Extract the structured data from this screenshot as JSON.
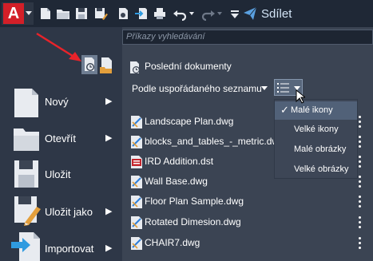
{
  "toolbar": {
    "app_letter": "A",
    "share_label": "Sdílet",
    "icons": [
      "new-icon",
      "open-icon",
      "save-icon",
      "save-as-icon",
      "open-web-icon",
      "import-icon",
      "plot-icon",
      "undo-icon",
      "redo-icon",
      "customize-icon",
      "share-icon"
    ]
  },
  "search": {
    "placeholder": "Příkazy vyhledávání"
  },
  "menu": {
    "items": [
      {
        "label": "Nový",
        "icon": "new-document-icon",
        "has_arrow": true
      },
      {
        "label": "Otevřít",
        "icon": "folder-icon",
        "has_arrow": true
      },
      {
        "label": "Uložit",
        "icon": "floppy-icon",
        "has_arrow": false
      },
      {
        "label": "Uložit jako",
        "icon": "save-as-floppy-icon",
        "has_arrow": true
      },
      {
        "label": "Importovat",
        "icon": "import-icon",
        "has_arrow": true
      }
    ]
  },
  "recent": {
    "title": "Poslední dokumenty",
    "sort_label": "Podle uspořádaného seznamu",
    "files": [
      {
        "name": "Landscape Plan.dwg",
        "type": "dwg"
      },
      {
        "name": "blocks_and_tables_-_metric.dwg",
        "type": "dwg"
      },
      {
        "name": "IRD Addition.dst",
        "type": "dst"
      },
      {
        "name": "Wall Base.dwg",
        "type": "dwg"
      },
      {
        "name": "Floor Plan Sample.dwg",
        "type": "dwg"
      },
      {
        "name": "Rotated Dimesion.dwg",
        "type": "dwg"
      },
      {
        "name": "CHAIR7.dwg",
        "type": "dwg"
      }
    ]
  },
  "view_dropdown": {
    "options": [
      "Malé ikony",
      "Velké ikony",
      "Malé obrázky",
      "Velké obrázky"
    ],
    "selected": "Malé ikony"
  },
  "colors": {
    "accent_red": "#d31f28",
    "share_blue": "#5aa0e0",
    "dwg_blue": "#2f7fd8"
  }
}
